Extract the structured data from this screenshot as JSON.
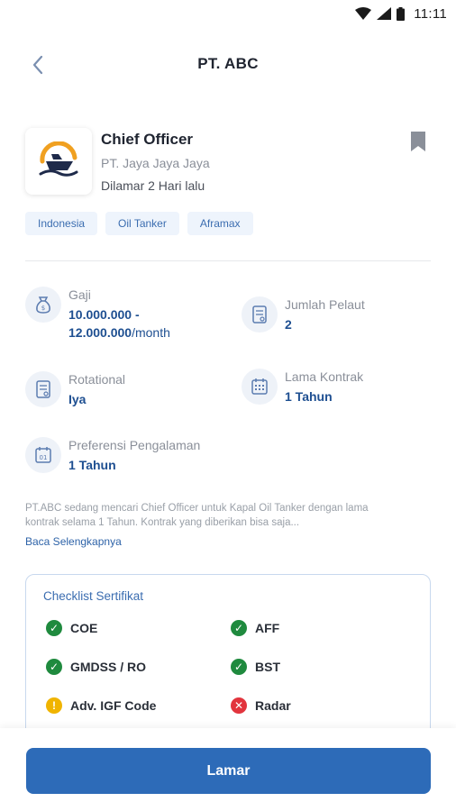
{
  "status_bar": {
    "time": "11:11"
  },
  "header": {
    "title": "PT. ABC"
  },
  "job": {
    "title": "Chief Officer",
    "company": "PT. Jaya Jaya Jaya",
    "posted": "Dilamar 2 Hari lalu",
    "tags": [
      "Indonesia",
      "Oil Tanker",
      "Aframax"
    ]
  },
  "info": {
    "gaji": {
      "label": "Gaji",
      "value": "10.000.000 -",
      "value2": "12.000.000",
      "unit": "/month"
    },
    "jumlah_pelaut": {
      "label": "Jumlah Pelaut",
      "value": "2"
    },
    "rotational": {
      "label": "Rotational",
      "value": "Iya"
    },
    "lama_kontrak": {
      "label": "Lama Kontrak",
      "value": "1 Tahun"
    },
    "preferensi": {
      "label": "Preferensi Pengalaman",
      "value": "1 Tahun"
    }
  },
  "description": {
    "text": "PT.ABC sedang mencari Chief Officer untuk Kapal Oil Tanker dengan lama kontrak selama 1 Tahun. Kontrak yang diberikan bisa saja...",
    "read_more": "Baca Selengkapnya"
  },
  "checklist": {
    "title": "Checklist Sertifikat",
    "items": [
      {
        "label": "COE",
        "status": "ok"
      },
      {
        "label": "AFF",
        "status": "ok"
      },
      {
        "label": "GMDSS / RO",
        "status": "ok"
      },
      {
        "label": "BST",
        "status": "ok"
      },
      {
        "label": "Adv. IGF Code",
        "status": "warn"
      },
      {
        "label": "Radar",
        "status": "no"
      }
    ]
  },
  "actions": {
    "apply": "Lamar"
  },
  "colors": {
    "primary": "#2d6bb8",
    "accent_text": "#1e4f91",
    "ok": "#1f8a3e",
    "warn": "#f0b400",
    "no": "#e2343d"
  },
  "icons": {
    "back": "chevron-left-icon",
    "bookmark": "bookmark-icon",
    "salary": "money-bag-icon",
    "crew": "document-icon",
    "rotational": "document-icon",
    "contract": "calendar-grid-icon",
    "experience": "calendar-icon"
  }
}
